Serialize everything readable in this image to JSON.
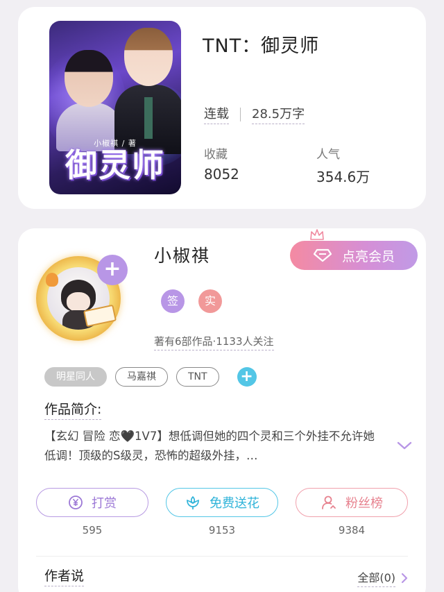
{
  "book": {
    "cover_title_art": "御灵师",
    "cover_author_art": "小椒祺 / 著",
    "title": "TNT：御灵师",
    "status": "连载",
    "word_count": "28.5万字",
    "favorites_label": "收藏",
    "favorites_value": "8052",
    "popularity_label": "人气",
    "popularity_value": "354.6万"
  },
  "author": {
    "name": "小椒祺",
    "follow_symbol": "+",
    "vip_label": "点亮会员",
    "badge_sign": "签",
    "badge_real": "实",
    "stats": "著有6部作品·1133人关注",
    "tags": [
      "明星同人",
      "马嘉祺",
      "TNT"
    ],
    "tag_add_symbol": "+"
  },
  "intro": {
    "label": "作品简介:",
    "text": "【玄幻 冒险 恋🖤1V7】想低调但她的四个灵和三个外挂不允许她低调！顶级的S级灵，恐怖的超级外挂，…"
  },
  "actions": {
    "tip": {
      "label": "打赏",
      "count": "595",
      "icon": "yen-coin-icon"
    },
    "flower": {
      "label": "免费送花",
      "count": "9153",
      "icon": "flower-icon"
    },
    "fans": {
      "label": "粉丝榜",
      "count": "9384",
      "icon": "user-icon"
    }
  },
  "author_says": {
    "label": "作者说",
    "all_label": "全部(0)"
  },
  "colors": {
    "purple_accent": "#b896e6",
    "cyan_accent": "#53c6e6",
    "pink_accent": "#f0a0ac",
    "vip_gradient_start": "#f48aa2",
    "vip_gradient_end": "#c09ae6"
  }
}
